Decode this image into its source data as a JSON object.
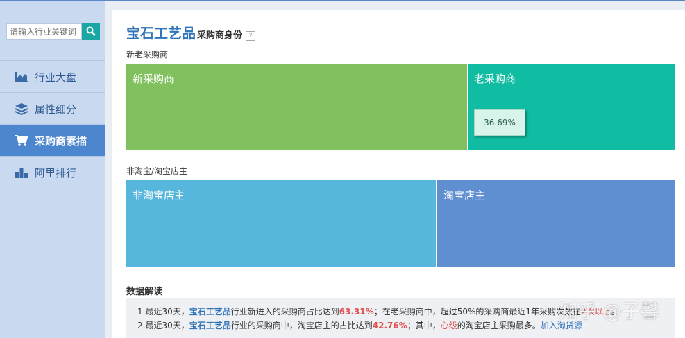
{
  "search": {
    "placeholder": "请输入行业关键词"
  },
  "nav": {
    "items": [
      {
        "label": "行业大盘",
        "icon": "area-chart-icon",
        "active": false
      },
      {
        "label": "属性细分",
        "icon": "layers-icon",
        "active": false
      },
      {
        "label": "采购商素描",
        "icon": "cart-icon",
        "active": true
      },
      {
        "label": "阿里排行",
        "icon": "bar-chart-icon",
        "active": false
      }
    ]
  },
  "header": {
    "title": "宝石工艺品",
    "subtitle": "采购商身份",
    "help": "?"
  },
  "sections": {
    "new_old": {
      "label": "新老采购商",
      "new": {
        "label": "新采购商",
        "share": 63.31,
        "color": "#80c15e"
      },
      "old": {
        "label": "老采购商",
        "share": 36.69,
        "color": "#10bda2"
      },
      "tooltip": "36.69%"
    },
    "taobao": {
      "label": "非淘宝/淘宝店主",
      "non": {
        "label": "非淘宝店主",
        "share": 57.24,
        "color": "#57b6db"
      },
      "yes": {
        "label": "淘宝店主",
        "share": 42.76,
        "color": "#5f8fd1"
      }
    }
  },
  "interpretation": {
    "title": "数据解读",
    "line1": {
      "a": "1.最近30天，",
      "kw": "宝石工艺品",
      "b": "行业新进入的采购商占比达到",
      "pct": "63.31%",
      "c": "；在老采购商中，超过50%的采购商最近1年采购次数在",
      "hl": "2次以上",
      "d": "。"
    },
    "line2": {
      "a": "2.最近30天，",
      "kw": "宝石工艺品",
      "b": "行业的采购商中，淘宝店主的占比达到",
      "pct": "42.76%",
      "c": "；其中，",
      "hl": "心级",
      "d": "的淘宝店主采购最多。",
      "link": "加入淘货源"
    }
  },
  "watermark": "知乎 @子馨"
}
